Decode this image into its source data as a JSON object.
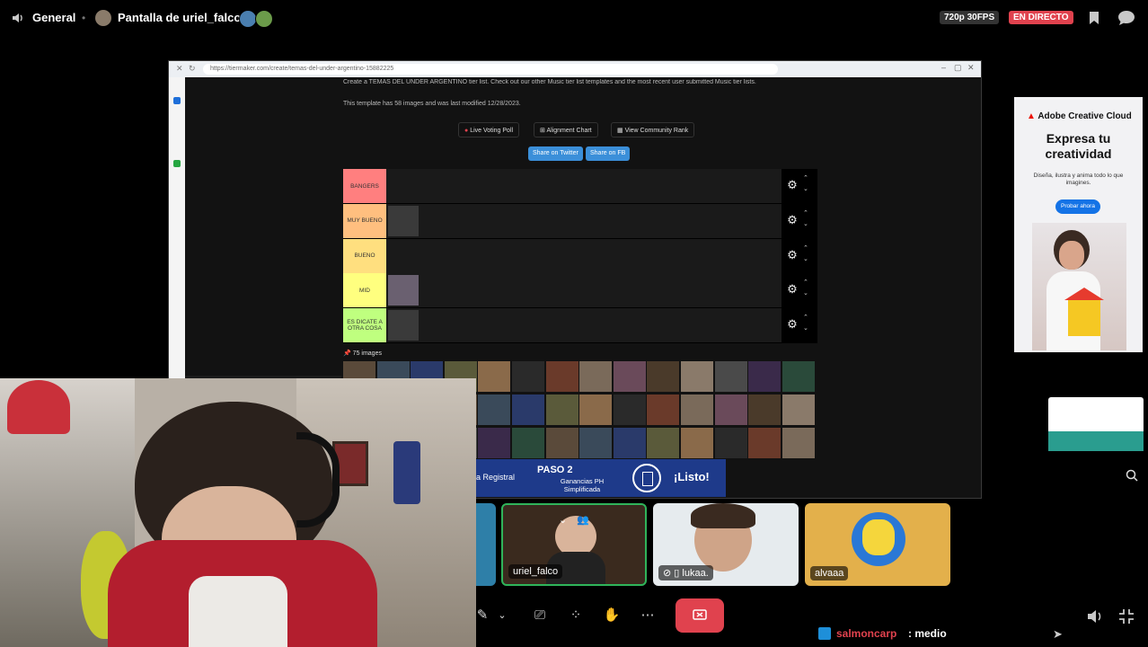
{
  "topbar": {
    "channel": "General",
    "stream_title": "Pantalla de uriel_falco",
    "quality": "720p 30FPS",
    "live": "EN DIRECTO"
  },
  "browser": {
    "url": "https://tiermaker.com/create/temas-del-under-argentino-15882225"
  },
  "page": {
    "intro": "Create a TEMAS DEL UNDER ARGENTINO tier list. Check out our other Music tier list templates and the most recent user submitted Music tier lists.",
    "modified": "This template has 58 images and was last modified 12/28/2023.",
    "btn_poll": "Live Voting Poll",
    "btn_align": "Alignment Chart",
    "btn_rank": "View Community Rank",
    "btn_twitter": "Share on Twitter",
    "btn_fb": "Share on FB",
    "images_label": "75 images"
  },
  "tiers": [
    {
      "label": "BANGERS",
      "color": "#ff7f7f"
    },
    {
      "label": "MUY BUENO",
      "color": "#ffbf7f"
    },
    {
      "label": "BUENO",
      "color": "#ffdf7f"
    },
    {
      "label": "MID",
      "color": "#ffff7f"
    },
    {
      "label": "ES DICATE A OTRA COSA",
      "color": "#bfff7f"
    }
  ],
  "ad": {
    "brand": "Adobe Creative Cloud",
    "title": "Expresa tu creatividad",
    "sub": "Diseña, ilustra y anima todo lo que imagines.",
    "cta": "Probar ahora"
  },
  "banner": {
    "left_text": "a Registral",
    "step": "PASO 2",
    "step_sub": "Ganancias PH Simplificada",
    "cta": "¡Listo!"
  },
  "participants": [
    {
      "name": "uriel_falco"
    },
    {
      "name": "lukaa."
    },
    {
      "name": "alvaaa"
    }
  ],
  "footer": {
    "user": "salmoncarp",
    "status": ": medio"
  },
  "colors": {
    "live_red": "#e0424e",
    "speaking_green": "#2fb45a",
    "leave_red": "#e0424e"
  }
}
